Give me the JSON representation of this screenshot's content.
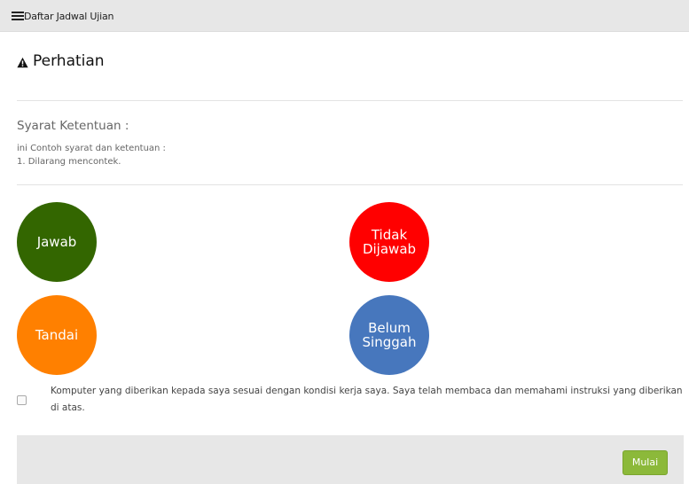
{
  "topbar": {
    "label": "Daftar Jadwal Ujian",
    "menu_icon": "hamburger-icon"
  },
  "header": {
    "title": "Perhatian",
    "warning_icon": "warning-triangle-icon"
  },
  "terms": {
    "heading": "Syarat Ketentuan :",
    "intro": "ini Contoh syarat dan ketentuan :",
    "rule": "1. Dilarang mencontek."
  },
  "legend": {
    "answered": {
      "label": "Jawab",
      "color": "#336600"
    },
    "unanswered": {
      "label_line1": "Tidak",
      "label_line2": "Dijawab",
      "color": "#ff0000"
    },
    "flagged": {
      "label": "Tandai",
      "color": "#ff8000"
    },
    "unvisited": {
      "label_line1": "Belum",
      "label_line2": "Singgah",
      "color": "#4777bd"
    }
  },
  "agreement": {
    "checked": false,
    "text": "Komputer yang diberikan kepada saya sesuai dengan kondisi kerja saya. Saya telah membaca dan memahami instruksi yang diberikan di atas."
  },
  "footer": {
    "start_label": "Mulai",
    "start_color": "#8cb93a"
  }
}
